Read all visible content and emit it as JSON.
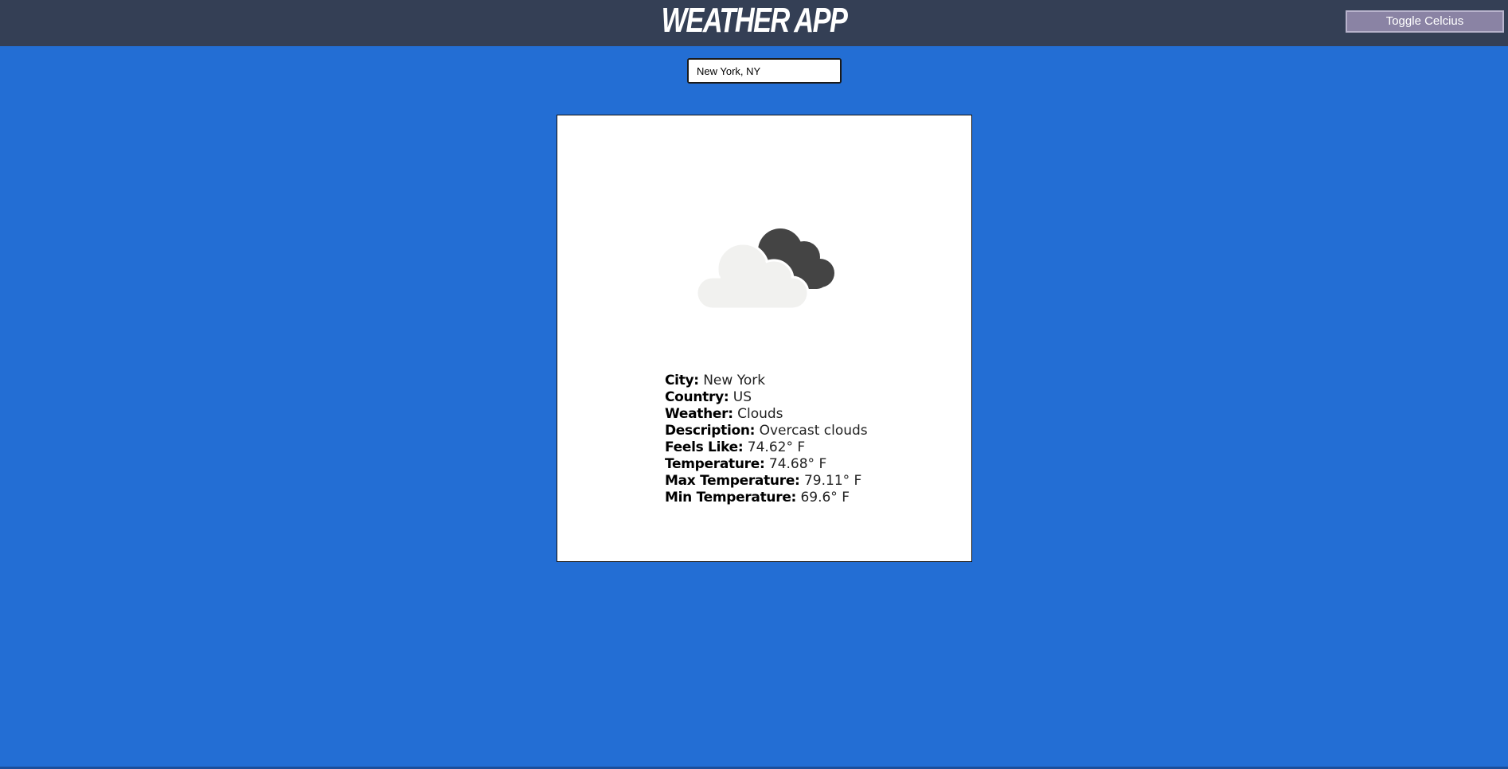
{
  "header": {
    "title": "WEATHER APP",
    "toggle_label": "Toggle Celcius"
  },
  "search": {
    "value": "New York, NY",
    "placeholder": ""
  },
  "weather": {
    "icon": "overcast-clouds-icon",
    "rows": [
      {
        "label": "City:",
        "value": "New York"
      },
      {
        "label": "Country:",
        "value": "US"
      },
      {
        "label": "Weather:",
        "value": "Clouds"
      },
      {
        "label": "Description:",
        "value": "Overcast clouds"
      },
      {
        "label": "Feels Like:",
        "value": "74.62° F"
      },
      {
        "label": "Temperature:",
        "value": "74.68° F"
      },
      {
        "label": "Max Temperature:",
        "value": "79.11° F"
      },
      {
        "label": "Min Temperature:",
        "value": "69.6° F"
      }
    ]
  },
  "colors": {
    "background": "#236ed4",
    "header": "#343f55",
    "button": "#8a83a4",
    "card": "#ffffff"
  }
}
